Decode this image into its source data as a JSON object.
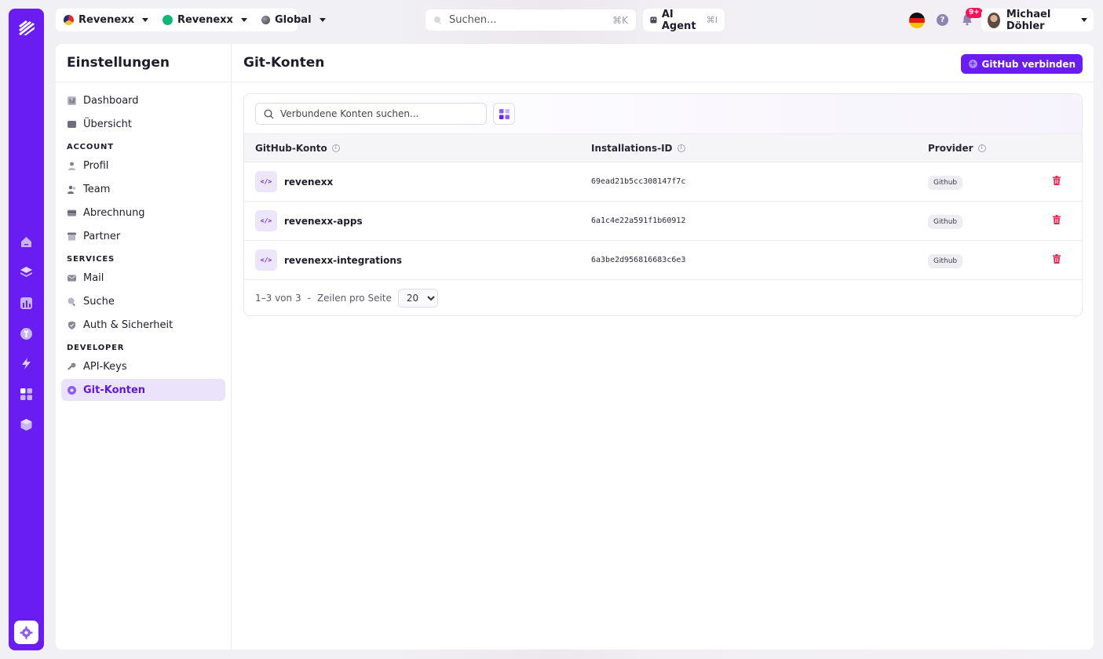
{
  "topbar": {
    "org1": "Revenexx",
    "org2": "Revenexx",
    "scope": "Global",
    "search_placeholder": "Suchen...",
    "search_shortcut": "⌘K",
    "ai_label": "AI Agent",
    "ai_shortcut": "⌘I",
    "notifications": "9+",
    "help": "?",
    "user_name": "Michael Döhler"
  },
  "settings": {
    "title": "Einstellungen",
    "items_top": [
      {
        "label": "Dashboard",
        "icon": "dashboard-icon"
      },
      {
        "label": "Übersicht",
        "icon": "overview-icon"
      }
    ],
    "section_account": "ACCOUNT",
    "items_account": [
      {
        "label": "Profil",
        "icon": "user-icon"
      },
      {
        "label": "Team",
        "icon": "team-icon"
      },
      {
        "label": "Abrechnung",
        "icon": "billing-icon"
      },
      {
        "label": "Partner",
        "icon": "store-icon"
      }
    ],
    "section_services": "SERVICES",
    "items_services": [
      {
        "label": "Mail",
        "icon": "mail-icon"
      },
      {
        "label": "Suche",
        "icon": "search-icon"
      },
      {
        "label": "Auth & Sicherheit",
        "icon": "shield-icon"
      }
    ],
    "section_developer": "DEVELOPER",
    "items_developer": [
      {
        "label": "API-Keys",
        "icon": "key-icon"
      },
      {
        "label": "Git-Konten",
        "icon": "git-icon"
      }
    ]
  },
  "page": {
    "title": "Git-Konten",
    "connect_button": "GitHub verbinden",
    "search_placeholder": "Verbundene Konten suchen...",
    "columns": [
      "GitHub-Konto",
      "Installations-ID",
      "Provider"
    ],
    "rows": [
      {
        "account": "revenexx",
        "installation_id": "69ead21b5cc308147f7c",
        "provider": "Github"
      },
      {
        "account": "revenexx-apps",
        "installation_id": "6a1c4e22a591f1b60912",
        "provider": "Github"
      },
      {
        "account": "revenexx-integrations",
        "installation_id": "6a3be2d956816683c6e3",
        "provider": "Github"
      }
    ],
    "pager": {
      "range": "1–3 von 3",
      "sep": "-",
      "rows_label": "Zeilen pro Seite",
      "page_size": "20"
    }
  },
  "colors": {
    "brand": "#6a1df2",
    "active_bg": "#ebe3fb",
    "danger": "#e8244f"
  }
}
